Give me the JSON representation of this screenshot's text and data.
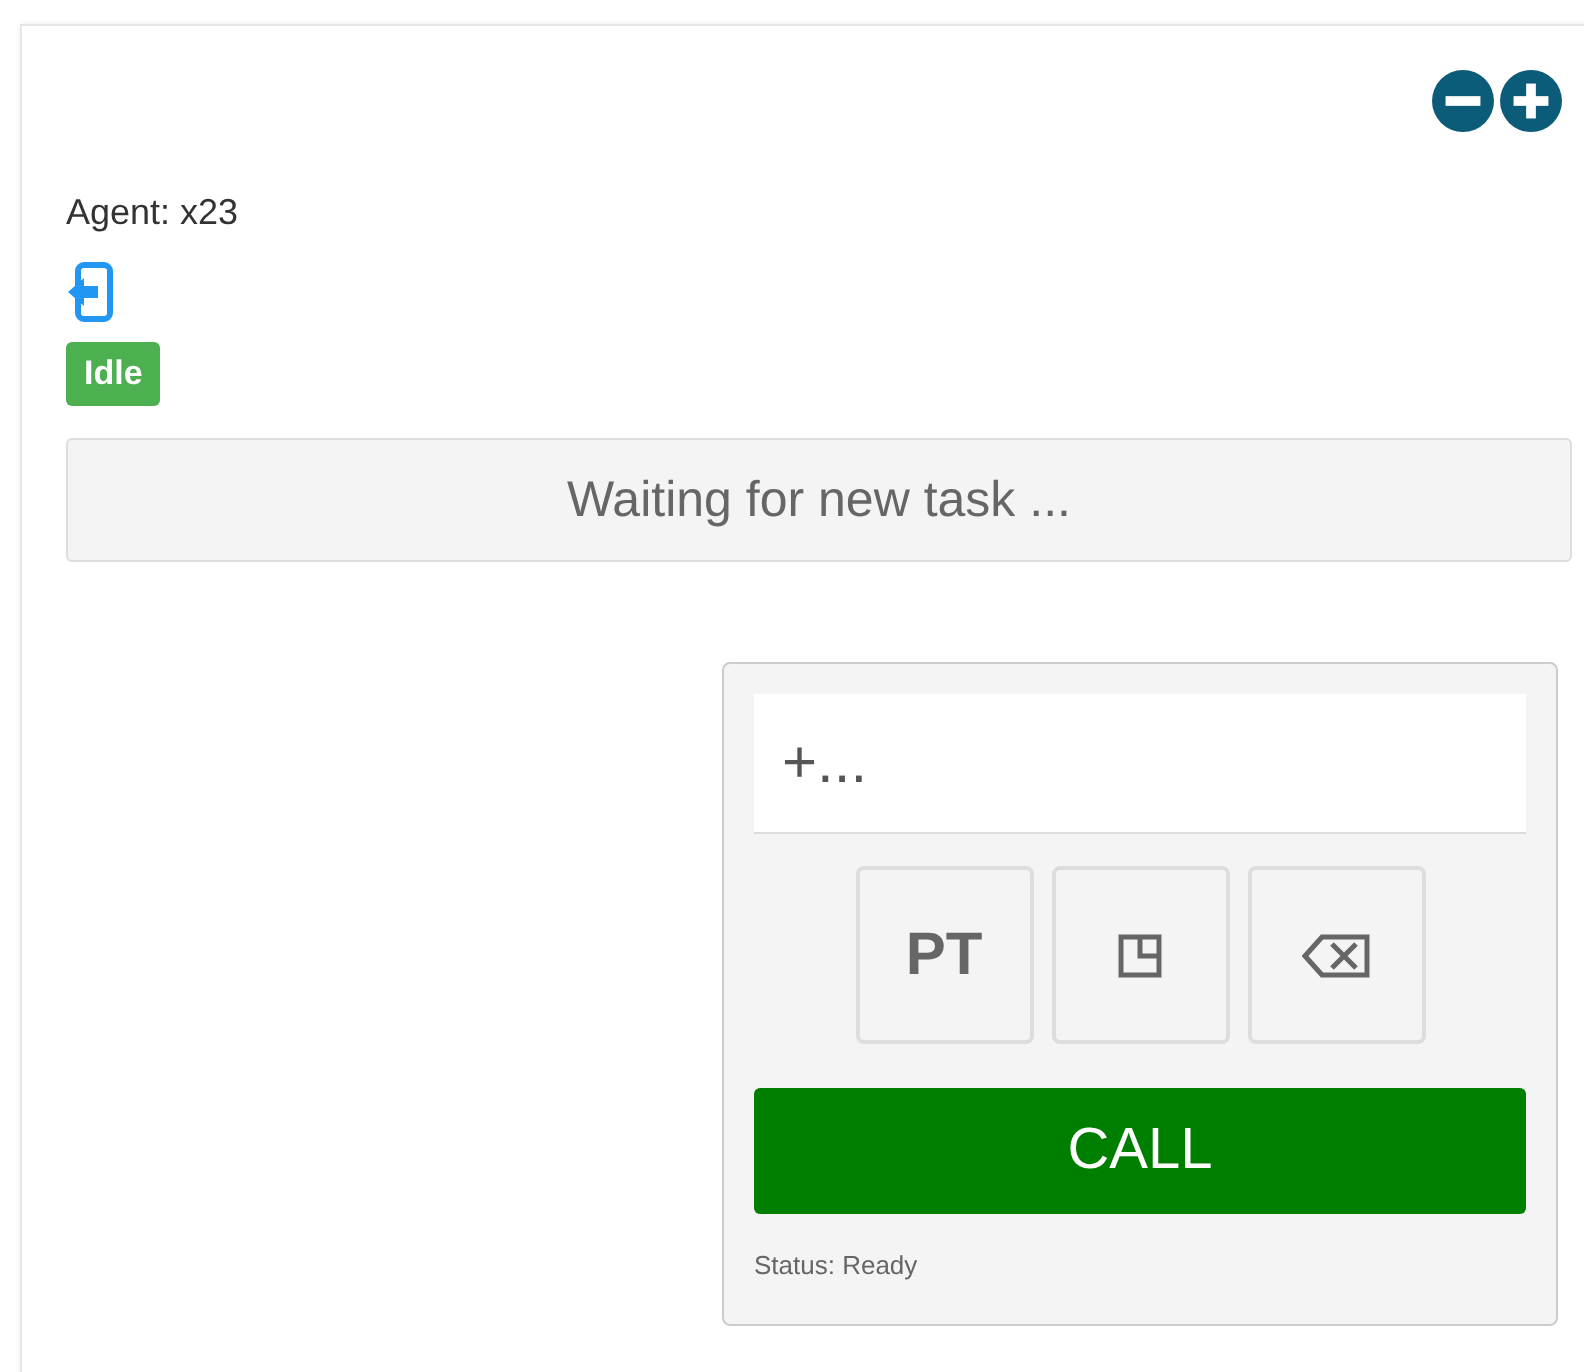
{
  "agent": {
    "label": "Agent: x23"
  },
  "status_badge": {
    "label": "Idle",
    "color": "#4caf50"
  },
  "task_bar": {
    "text": "Waiting for new task ..."
  },
  "dialer": {
    "number_field": {
      "placeholder": "+..."
    },
    "keys": [
      {
        "kind": "text",
        "label": "PT"
      },
      {
        "kind": "split"
      },
      {
        "kind": "backspace"
      }
    ],
    "call_button": {
      "label": "CALL"
    },
    "status": "Status: Ready"
  }
}
